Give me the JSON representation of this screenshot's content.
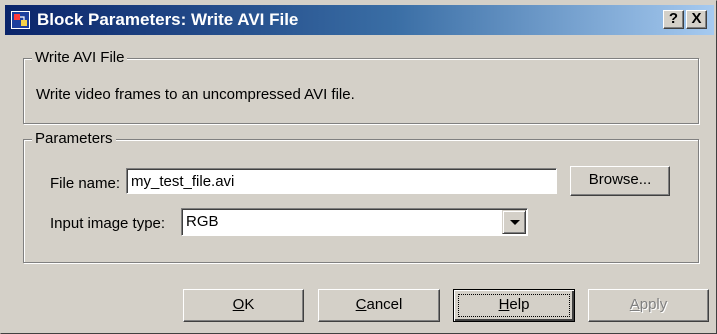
{
  "window": {
    "title": "Block Parameters: Write AVI File",
    "help_glyph": "?",
    "close_glyph": "X"
  },
  "description": {
    "group_title": "Write AVI File",
    "text": "Write video frames to an uncompressed AVI file."
  },
  "parameters": {
    "group_title": "Parameters",
    "file_name_label": "File name:",
    "file_name_value": "my_test_file.avi",
    "browse_label": "Browse...",
    "image_type_label": "Input image type:",
    "image_type_value": "RGB"
  },
  "buttons": {
    "ok": {
      "mnemonic": "O",
      "rest": "K"
    },
    "cancel": {
      "mnemonic": "C",
      "rest": "ancel"
    },
    "help": {
      "mnemonic": "H",
      "rest": "elp"
    },
    "apply": {
      "mnemonic": "A",
      "rest": "pply"
    }
  },
  "icons": {
    "app_icon": "simulink-block-icon",
    "dropdown_arrow": "chevron-down-icon"
  }
}
